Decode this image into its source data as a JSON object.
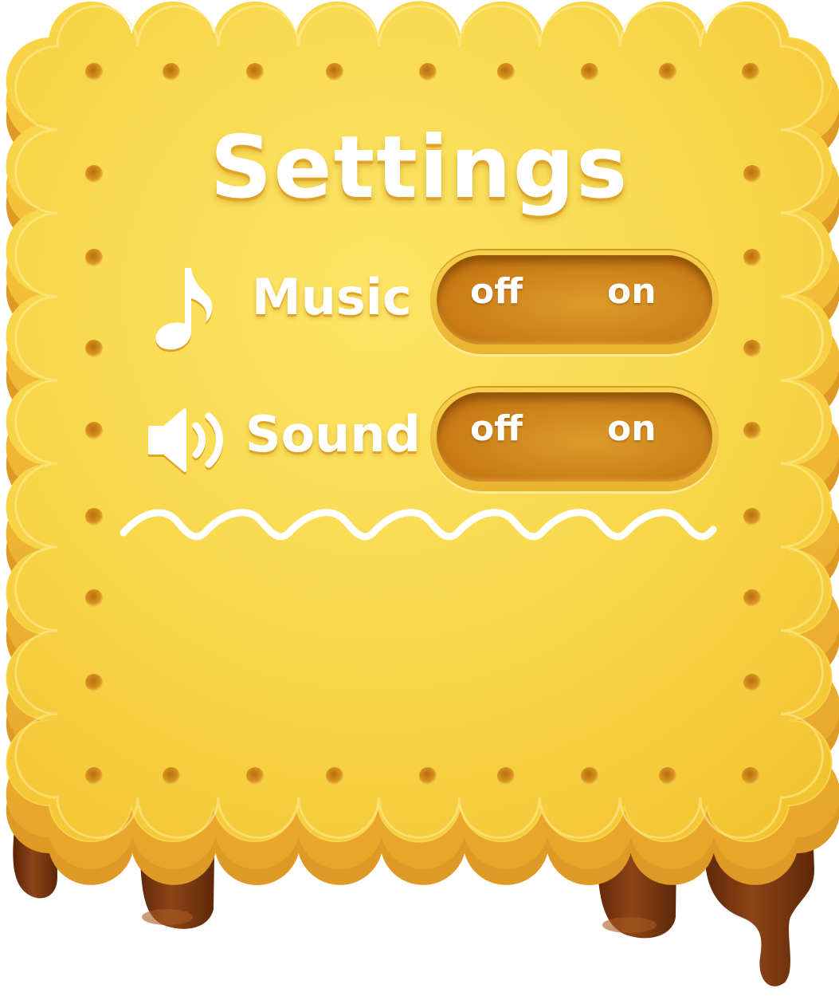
{
  "dialog": {
    "title": "Settings",
    "icons": [
      "music-note-icon",
      "speaker-icon"
    ],
    "colors": {
      "biscuit_light": "#fbe05e",
      "biscuit_main": "#f5c833",
      "biscuit_edge": "#e7a928",
      "biscuit_shadow": "#d9901f",
      "chocolate": "#7a3a12",
      "toggle_track": "#c97d17",
      "text": "#ffffff"
    }
  },
  "settings": [
    {
      "label": "Music",
      "icon": "music-note-icon",
      "off_label": "off",
      "on_label": "on"
    },
    {
      "label": "Sound",
      "icon": "speaker-icon",
      "off_label": "off",
      "on_label": "on"
    }
  ]
}
